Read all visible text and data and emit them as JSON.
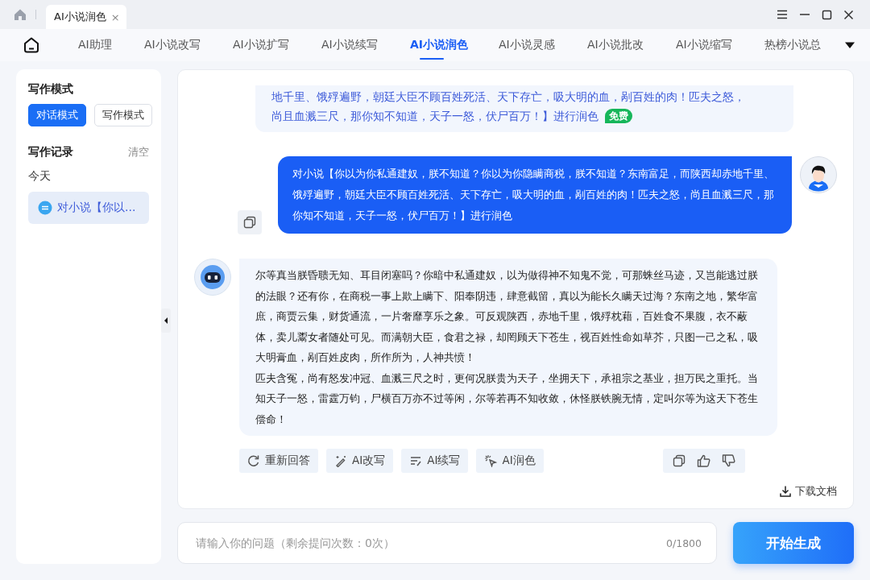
{
  "title_bar": {
    "tab": {
      "label": "AI小说润色",
      "close": "×"
    }
  },
  "nav": {
    "tabs": [
      {
        "label": "AI助理",
        "selected": false
      },
      {
        "label": "AI小说改写",
        "selected": false
      },
      {
        "label": "AI小说扩写",
        "selected": false
      },
      {
        "label": "AI小说续写",
        "selected": false
      },
      {
        "label": "AI小说润色",
        "selected": true
      },
      {
        "label": "AI小说灵感",
        "selected": false
      },
      {
        "label": "AI小说批改",
        "selected": false
      },
      {
        "label": "AI小说缩写",
        "selected": false
      },
      {
        "label": "热榜小说总",
        "selected": false
      }
    ]
  },
  "sidebar": {
    "mode_title": "写作模式",
    "modes": [
      {
        "label": "对话模式",
        "selected": true
      },
      {
        "label": "写作模式",
        "selected": false
      }
    ],
    "history_title": "写作记录",
    "clear": "清空",
    "group": "今天",
    "items": [
      {
        "label": "对小说【你以...",
        "selected": true
      }
    ]
  },
  "chat": {
    "messages": [
      {
        "kind": "prompt",
        "lines": [
          "地千里、饿殍遍野，朝廷大臣不顾百姓死活、天下存亡，吸大明的血，剐百姓的肉！匹夫之怒，",
          "尚且血溅三尺，那你知不知道，天子一怒，伏尸百万！】进行润色"
        ],
        "badge": "免费"
      },
      {
        "kind": "user",
        "text": "对小说【你以为你私通建奴，朕不知道？你以为你隐瞒商税，朕不知道？东南富足，而陕西却赤地千里、饿殍遍野，朝廷大臣不顾百姓死活、天下存亡，吸大明的血，剐百姓的肉！匹夫之怒，尚且血溅三尺，那你知不知道，天子一怒，伏尸百万！】进行润色"
      },
      {
        "kind": "bot",
        "paragraphs": [
          "尔等真当朕昏聩无知、耳目闭塞吗？你暗中私通建奴，以为做得神不知鬼不觉，可那蛛丝马迹，又岂能逃过朕的法眼？还有你，在商税一事上欺上瞒下、阳奉阴违，肆意截留，真以为能长久瞒天过海？东南之地，繁华富庶，商贾云集，财货通流，一片奢靡享乐之象。可反观陕西，赤地千里，饿殍枕藉，百姓食不果腹，衣不蔽体，卖儿鬻女者随处可见。而满朝大臣，食君之禄，却罔顾天下苍生，视百姓性命如草芥，只图一己之私，吸大明膏血，剐百姓皮肉，所作所为，人神共愤！",
          "匹夫含冤，尚有怒发冲冠、血溅三尺之时，更何况朕贵为天子，坐拥天下，承祖宗之基业，担万民之重托。当知天子一怒，雷霆万钧，尸横百万亦不过等闲，尔等若再不知收敛，休怪朕铁腕无情，定叫尔等为这天下苍生偿命！"
        ]
      }
    ],
    "actions": [
      {
        "kind": "regenerate",
        "label": "重新回答"
      },
      {
        "kind": "rewrite",
        "label": "AI改写"
      },
      {
        "kind": "continue",
        "label": "AI续写"
      },
      {
        "kind": "polish",
        "label": "AI润色"
      }
    ],
    "download": "下载文档"
  },
  "input": {
    "placeholder": "请输入你的问题（剩余提问次数：0次）",
    "counter": "0/1800"
  },
  "submit": "开始生成"
}
